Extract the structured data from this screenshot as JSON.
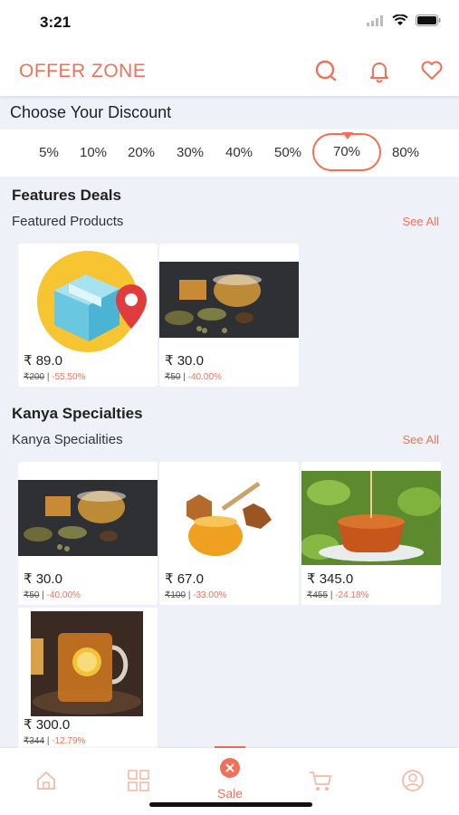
{
  "status": {
    "time": "3:21"
  },
  "header": {
    "title": "OFFER ZONE",
    "icons": [
      "search-icon",
      "bell-icon",
      "heart-icon"
    ]
  },
  "discount": {
    "title": "Choose Your Discount",
    "options": [
      "5%",
      "10%",
      "20%",
      "30%",
      "40%",
      "50%",
      "70%",
      "80%"
    ],
    "selected": "70%"
  },
  "featured": {
    "title": "Features Deals",
    "subtitle": "Featured Products",
    "see_all": "See All",
    "items": [
      {
        "price": "₹ 89.0",
        "old": "₹200",
        "pct": "-55.50%",
        "image": "delivery-box-icon"
      },
      {
        "price": "₹ 30.0",
        "old": "₹50",
        "pct": "-40.00%",
        "image": "tea-spices-photo"
      }
    ]
  },
  "kanya": {
    "title": "Kanya Specialties",
    "subtitle": "Kanya Specialities",
    "see_all": "See All",
    "items": [
      {
        "price": "₹ 30.0",
        "old": "₹50",
        "pct": "-40.00%",
        "image": "tea-spices-photo"
      },
      {
        "price": "₹ 67.0",
        "old": "₹100",
        "pct": "-33.00%",
        "image": "honey-photo"
      },
      {
        "price": "₹ 345.0",
        "old": "₹455",
        "pct": "-24.18%",
        "image": "tea-cup-photo"
      },
      {
        "price": "₹ 300.0",
        "old": "₹344",
        "pct": "-12.79%",
        "image": "lemon-tea-photo"
      }
    ]
  },
  "bottom_nav": {
    "items": [
      "home-icon",
      "grid-icon",
      "sale-icon",
      "cart-icon",
      "profile-icon"
    ],
    "sale_label": "Sale"
  },
  "colors": {
    "accent": "#f0715a",
    "background": "#eef1f8"
  }
}
